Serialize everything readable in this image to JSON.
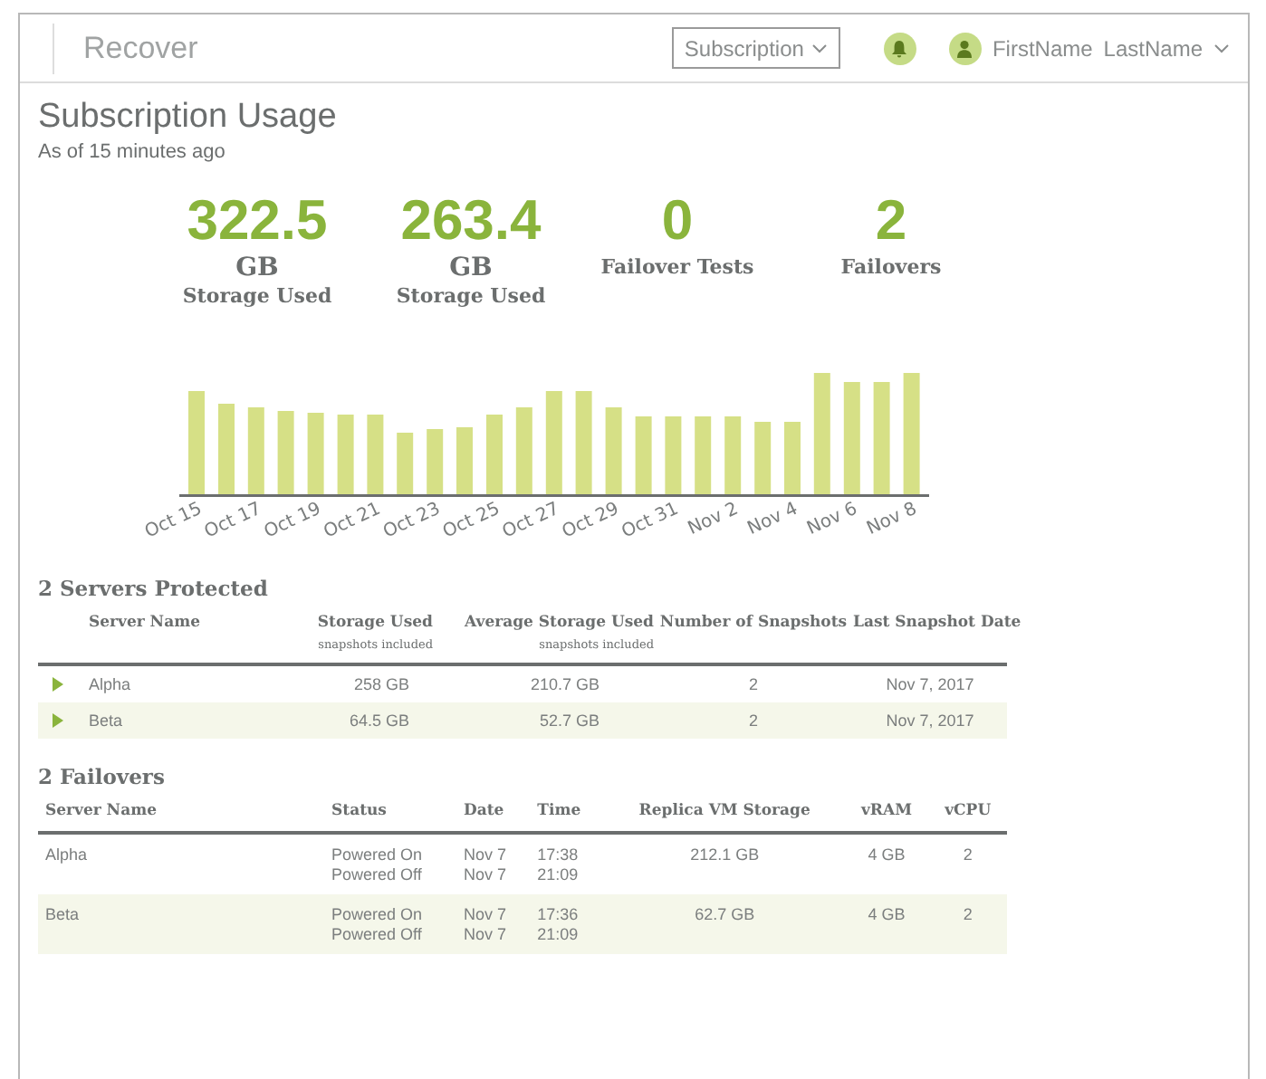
{
  "header": {
    "app_title": "Recover",
    "subscription_menu": "Subscription",
    "user_first": "FirstName",
    "user_last": "LastName"
  },
  "page": {
    "title": "Subscription Usage",
    "subtitle": "As of 15 minutes ago"
  },
  "stats": [
    {
      "value": "322.5",
      "unit": "GB",
      "label": "Storage Used"
    },
    {
      "value": "263.4",
      "unit": "GB",
      "label": "Storage Used"
    },
    {
      "value": "0",
      "label": "Failover Tests"
    },
    {
      "value": "2",
      "label": "Failovers"
    }
  ],
  "usage_chart": {
    "x_labels": [
      "Oct 15",
      "Oct 17",
      "Oct 19",
      "Oct 21",
      "Oct 23",
      "Oct 25",
      "Oct 27",
      "Oct 29",
      "Oct 31",
      "Nov 2",
      "Nov 4",
      "Nov 6",
      "Nov 8"
    ]
  },
  "servers": {
    "heading": "2 Servers Protected",
    "columns": [
      {
        "label": "Server Name"
      },
      {
        "label": "Storage Used",
        "note": "snapshots included"
      },
      {
        "label": "Average Storage Used",
        "note": "snapshots included"
      },
      {
        "label": "Number of Snapshots"
      },
      {
        "label": "Last Snapshot Date"
      }
    ],
    "rows": [
      {
        "expanded": false,
        "cells": [
          "Alpha",
          "258 GB",
          "210.7 GB",
          "2",
          "Nov 7, 2017"
        ]
      },
      {
        "expanded": false,
        "cells": [
          "Beta",
          "64.5 GB",
          "52.7 GB",
          "2",
          "Nov 7, 2017"
        ]
      }
    ]
  },
  "failovers": {
    "heading": "2 Failovers",
    "columns": [
      "Server Name",
      "Status",
      "Date",
      "Time",
      "Replica VM Storage",
      "vRAM",
      "vCPU"
    ],
    "rows": [
      {
        "server": "Alpha",
        "events": [
          {
            "status": "Powered On",
            "date": "Nov 7",
            "time": "17:38"
          },
          {
            "status": "Powered Off",
            "date": "Nov 7",
            "time": "21:09"
          }
        ],
        "storage": "212.1 GB",
        "vram": "4 GB",
        "vcpu": "2"
      },
      {
        "server": "Beta",
        "events": [
          {
            "status": "Powered On",
            "date": "Nov 7",
            "time": "17:36"
          },
          {
            "status": "Powered Off",
            "date": "Nov 7",
            "time": "21:09"
          }
        ],
        "storage": "62.7 GB",
        "vram": "4 GB",
        "vcpu": "2"
      }
    ]
  }
}
